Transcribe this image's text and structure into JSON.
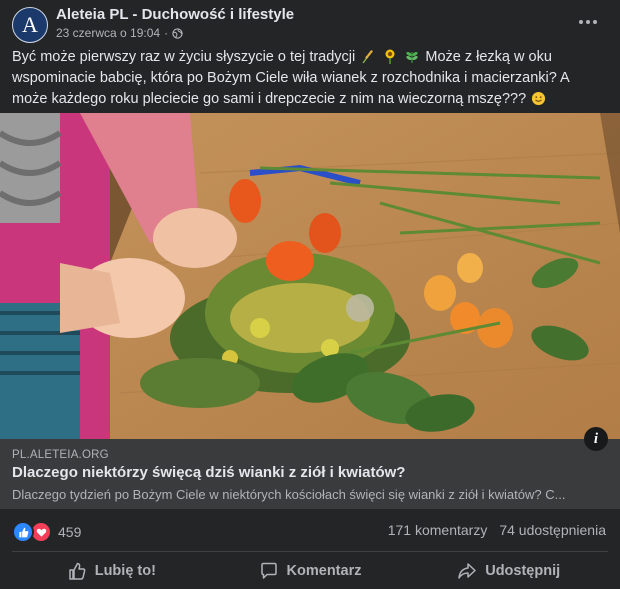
{
  "post": {
    "page_name": "Aleteia PL - Duchowość i lifestyle",
    "avatar_letter": "A",
    "date": "23 czerwca o 19:04",
    "separator": "·",
    "text_part1": "Być może pierwszy raz w życiu słyszycie o tej tradycji",
    "text_part2": "Może z łezką w oku wspominacie babcię, która po Bożym Ciele wiła wianek z rozchodnika i macierzanki? A może każdego roku pleciecie go sami i drepczecie z nim na wieczorną mszę???"
  },
  "link": {
    "domain": "PL.ALETEIA.ORG",
    "title": "Dlaczego niektórzy święcą dziś wianki z ziół i kwiatów?",
    "description": "Dlaczego tydzień po Bożym Ciele w niektórych kościołach święci się wianki z ziół i kwiatów? C..."
  },
  "stats": {
    "reactions_count": "459",
    "comments": "171 komentarzy",
    "shares": "74 udostępnienia"
  },
  "actions": {
    "like": "Lubię to!",
    "comment": "Komentarz",
    "share": "Udostępnij"
  },
  "icons": [
    "globe-icon",
    "more-icon",
    "wheat-emoji",
    "sunflower-emoji",
    "herb-emoji",
    "smile-emoji",
    "info-icon",
    "like-reaction-icon",
    "love-reaction-icon",
    "thumbs-up-icon",
    "comment-icon",
    "share-icon"
  ],
  "colors": {
    "background": "#242526",
    "link_bar": "#3a3b3c",
    "like_blue": "#2d88ff",
    "love_red": "#f33e58",
    "text_primary": "#e4e6eb",
    "text_secondary": "#b0b3b8"
  }
}
